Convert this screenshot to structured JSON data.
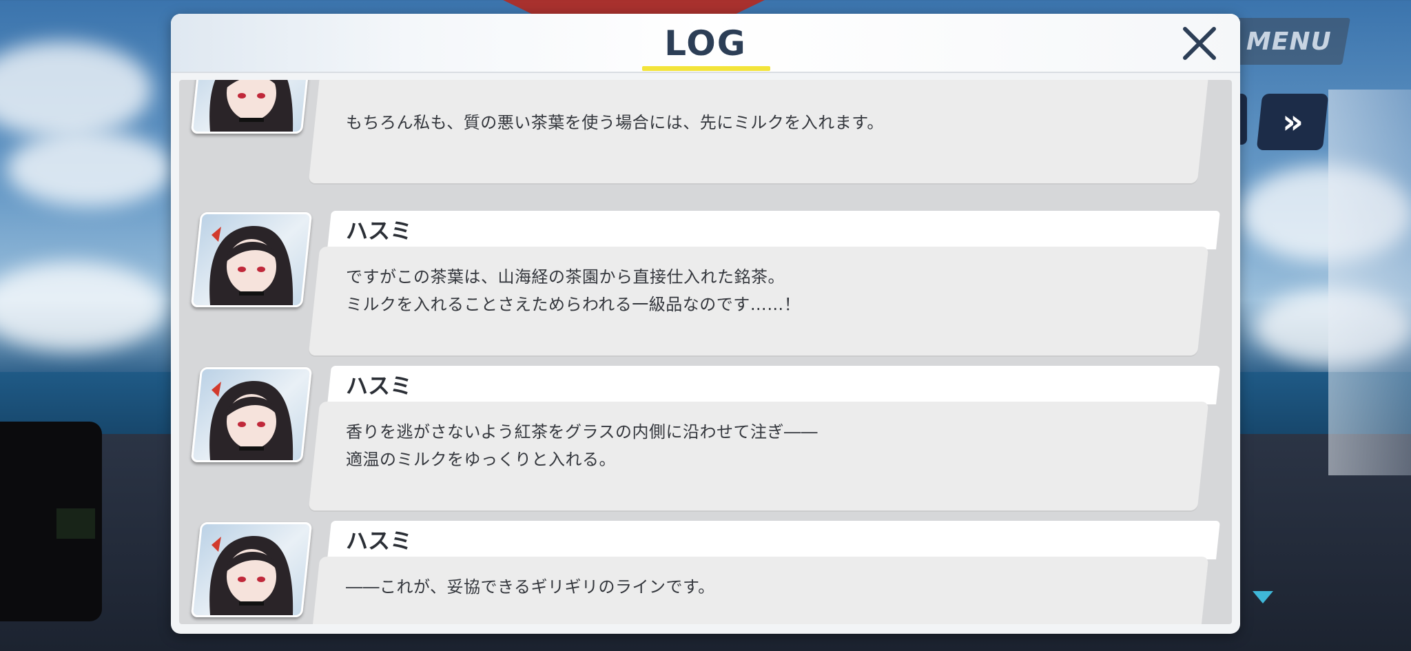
{
  "menu_label": "MENU",
  "skip_label": "»",
  "log": {
    "title": "LOG",
    "entries": [
      {
        "speaker": "",
        "lines": [
          "もちろん私も、質の悪い茶葉を使う場合には、先にミルクを入れます。"
        ]
      },
      {
        "speaker": "ハスミ",
        "lines": [
          "ですがこの茶葉は、山海経の茶園から直接仕入れた銘茶。",
          "ミルクを入れることさえためらわれる一級品なのです……！"
        ]
      },
      {
        "speaker": "ハスミ",
        "lines": [
          "香りを逃がさないよう紅茶をグラスの内側に沿わせて注ぎ――",
          "適温のミルクをゆっくりと入れる。"
        ]
      },
      {
        "speaker": "ハスミ",
        "lines": [
          "――これが、妥協できるギリギリのラインです。"
        ]
      }
    ]
  },
  "colors": {
    "title_text": "#2c3e56",
    "title_underline": "#f3e43a",
    "skip_button": "#1c2c48",
    "indicator": "#3fb7d8"
  },
  "icons": [
    "close-icon",
    "skip-icon",
    "scroll-down-indicator-icon"
  ]
}
